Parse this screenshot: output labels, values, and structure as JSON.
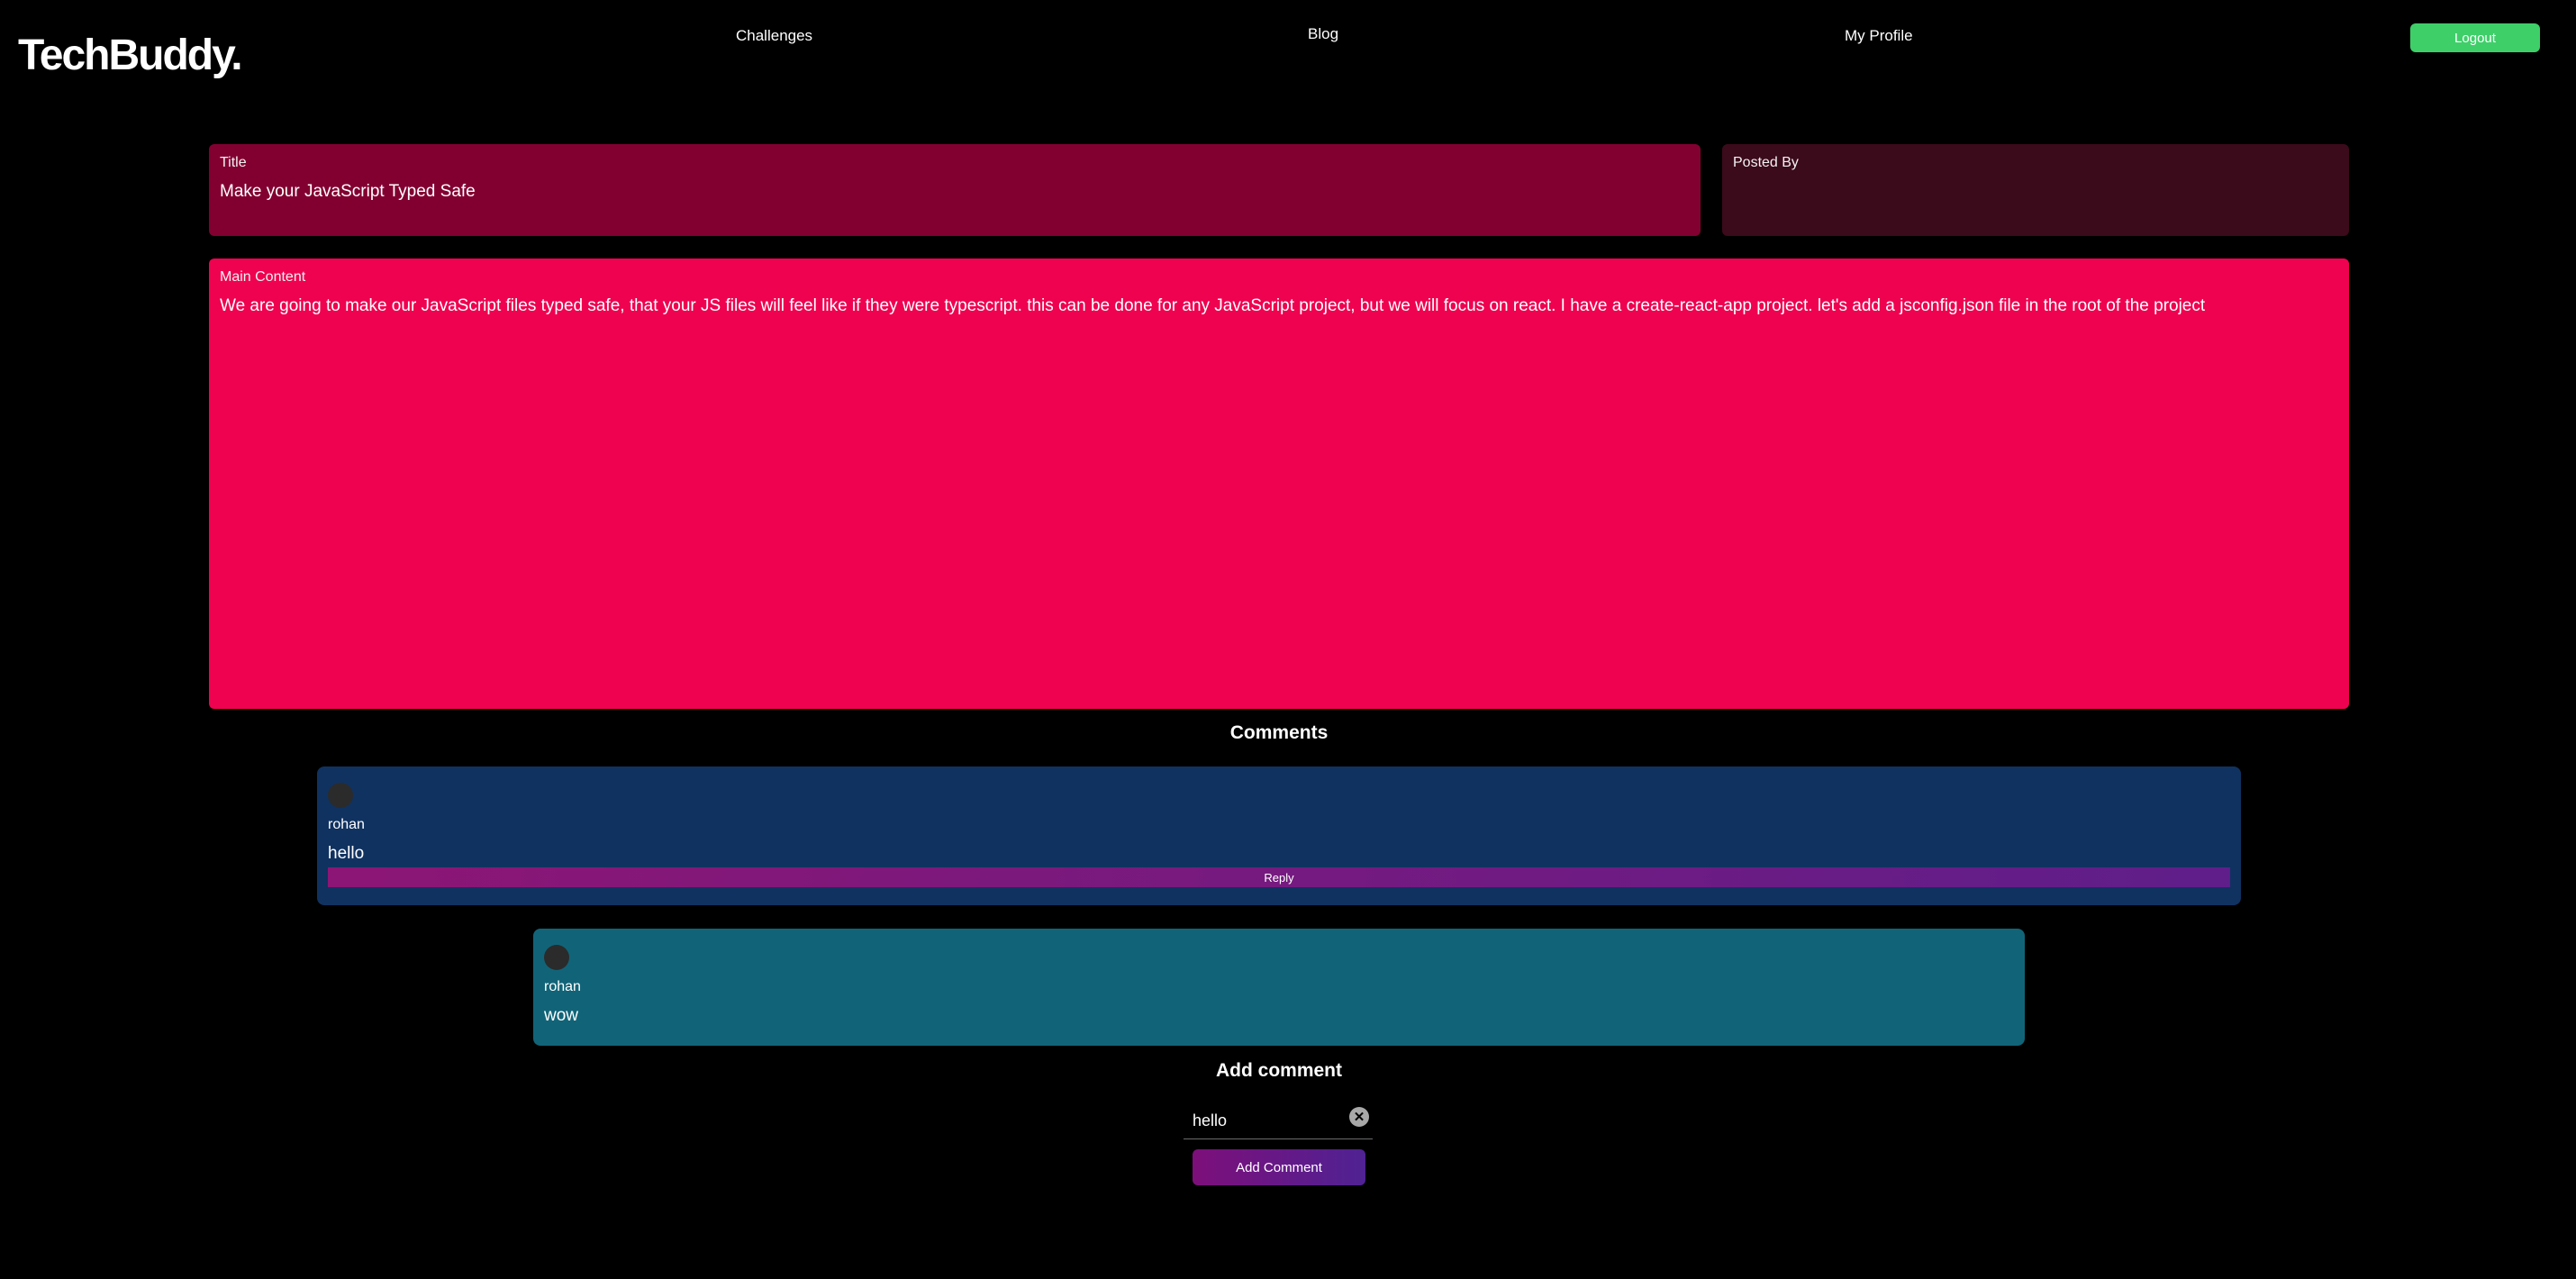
{
  "header": {
    "brand": "TechBuddy.",
    "nav": {
      "challenges": "Challenges",
      "blog": "Blog",
      "profile": "My Profile"
    },
    "logout_label": "Logout"
  },
  "post": {
    "title_label": "Title",
    "title_value": "Make your JavaScript Typed Safe",
    "posted_by_label": "Posted By",
    "posted_by_value": "",
    "content_label": "Main Content",
    "content_value": "We are going to make our JavaScript files typed safe, that your JS files will feel like if they were typescript. this can be done for any JavaScript project, but we will focus on react. I have a create-react-app project. let's add a jsconfig.json file in the root of the project"
  },
  "comments": {
    "heading": "Comments",
    "items": [
      {
        "author": "rohan",
        "text": "hello",
        "reply_label": "Reply"
      },
      {
        "author": "rohan",
        "text": "wow"
      }
    ]
  },
  "add_comment": {
    "heading": "Add comment",
    "input_value": "hello",
    "clear_icon": "✕",
    "button_label": "Add Comment"
  },
  "colors": {
    "background": "#000000",
    "title_box": "#820030",
    "posted_box": "#3b0a1b",
    "content_box": "#ef0250",
    "comment_primary": "#103260",
    "comment_reply": "#116478",
    "logout": "#3ecf69"
  }
}
